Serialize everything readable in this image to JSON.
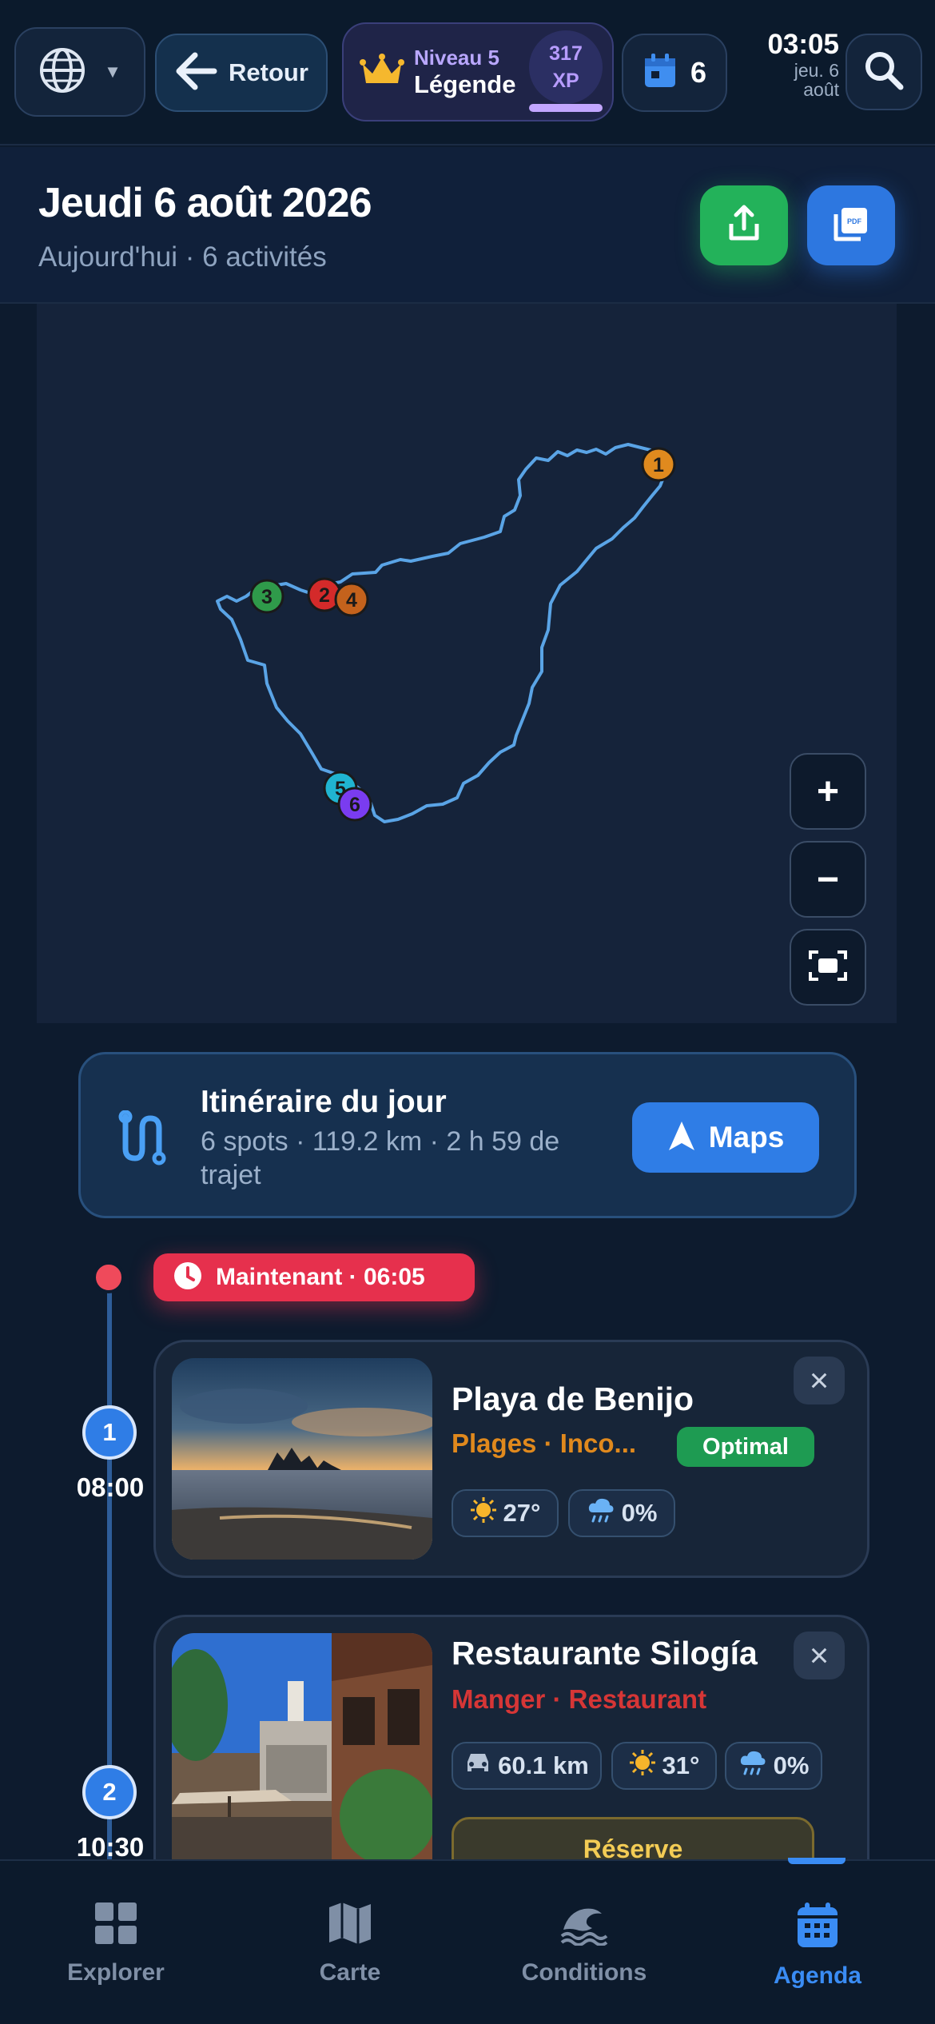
{
  "topbar": {
    "back_label": "Retour",
    "level_label": "Niveau 5",
    "level_name": "Légende",
    "xp_value": "317",
    "xp_unit": "XP",
    "calendar_count": "6",
    "time": "03:05",
    "date_line1": "jeu. 6",
    "date_line2": "août"
  },
  "day_header": {
    "title": "Jeudi 6 août 2026",
    "subtitle": "Aujourd'hui · 6 activités"
  },
  "map": {
    "markers": [
      {
        "label": "1",
        "color": "#e08a1e"
      },
      {
        "label": "2",
        "color": "#d42a2a"
      },
      {
        "label": "3",
        "color": "#2f9a4a"
      },
      {
        "label": "4",
        "color": "#c4621c"
      },
      {
        "label": "5",
        "color": "#20b4d0"
      },
      {
        "label": "6",
        "color": "#7a3cf0"
      }
    ],
    "controls": {
      "zoom_in": "+",
      "zoom_out": "−"
    }
  },
  "itinerary": {
    "title": "Itinéraire du jour",
    "summary": "6 spots · 119.2 km · 2 h 59 de trajet",
    "maps_label": "Maps"
  },
  "now": {
    "label": "Maintenant · 06:05"
  },
  "activities": [
    {
      "step": "1",
      "time": "08:00",
      "name": "Playa de Benijo",
      "category": "Plages · Inco...",
      "category_color": "#e0891d",
      "status": "Optimal",
      "temperature": "27°",
      "rain": "0%"
    },
    {
      "step": "2",
      "time": "10:30",
      "name": "Restaurante Silogía",
      "category": "Manger · Restaurant",
      "category_color": "#d63636",
      "distance": "60.1 km",
      "temperature": "31°",
      "rain": "0%",
      "reserve_label": "Réserve"
    }
  ],
  "bottom_nav": [
    {
      "label": "Explorer",
      "icon": "grid-icon",
      "active": false
    },
    {
      "label": "Carte",
      "icon": "map-icon",
      "active": false
    },
    {
      "label": "Conditions",
      "icon": "wave-icon",
      "active": false
    },
    {
      "label": "Agenda",
      "icon": "calendar-icon",
      "active": true
    }
  ],
  "colors": {
    "accent": "#2f7de6",
    "active_nav": "#3a8cf4",
    "inactive_nav": "#7f8fa6",
    "now_red": "#e6304d",
    "optimal_green": "#1e9b52",
    "route_line": "#5aa4e6"
  }
}
